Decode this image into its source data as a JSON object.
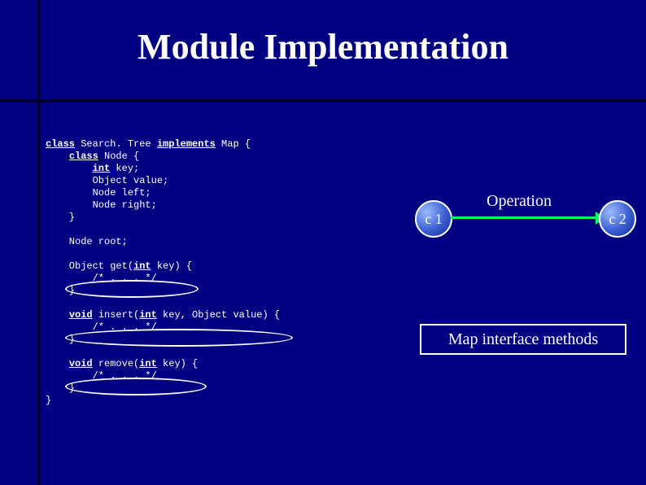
{
  "title": "Module Implementation",
  "diagram": {
    "c1": "c 1",
    "c2": "c 2",
    "operation": "Operation"
  },
  "caption": "Map interface methods",
  "code_plain": "class Search. Tree implements Map {\n    class Node {\n        int key;\n        Object value;\n        Node left;\n        Node right;\n    }\n\n    Node root;\n\n    Object get(int key) {\n        /* . . . */\n    }\n\n    void insert(int key, Object value) {\n        /* . . . */\n    }\n\n    void remove(int key) {\n        /* . . . */\n    }\n}",
  "code": {
    "l0a": "class",
    "l0b": " Search. Tree ",
    "l0c": "implements",
    "l0d": " Map {",
    "l1a": "    ",
    "l1b": "class",
    "l1c": " Node {",
    "l2a": "        ",
    "l2b": "int",
    "l2c": " key;",
    "l3": "        Object value;",
    "l4": "        Node left;",
    "l5": "        Node right;",
    "l6": "    }",
    "l7": "",
    "l8": "    Node root;",
    "l9": "",
    "l10a": "    Object get(",
    "l10b": "int",
    "l10c": " key) {",
    "l11": "        /* . . . */",
    "l12": "    }",
    "l13": "",
    "l14a": "    ",
    "l14b": "void",
    "l14c": " insert(",
    "l14d": "int",
    "l14e": " key, Object value) {",
    "l15": "        /* . . . */",
    "l16": "    }",
    "l17": "",
    "l18a": "    ",
    "l18b": "void",
    "l18c": " remove(",
    "l18d": "int",
    "l18e": " key) {",
    "l19": "        /* . . . */",
    "l20": "    }",
    "l21": "}"
  }
}
